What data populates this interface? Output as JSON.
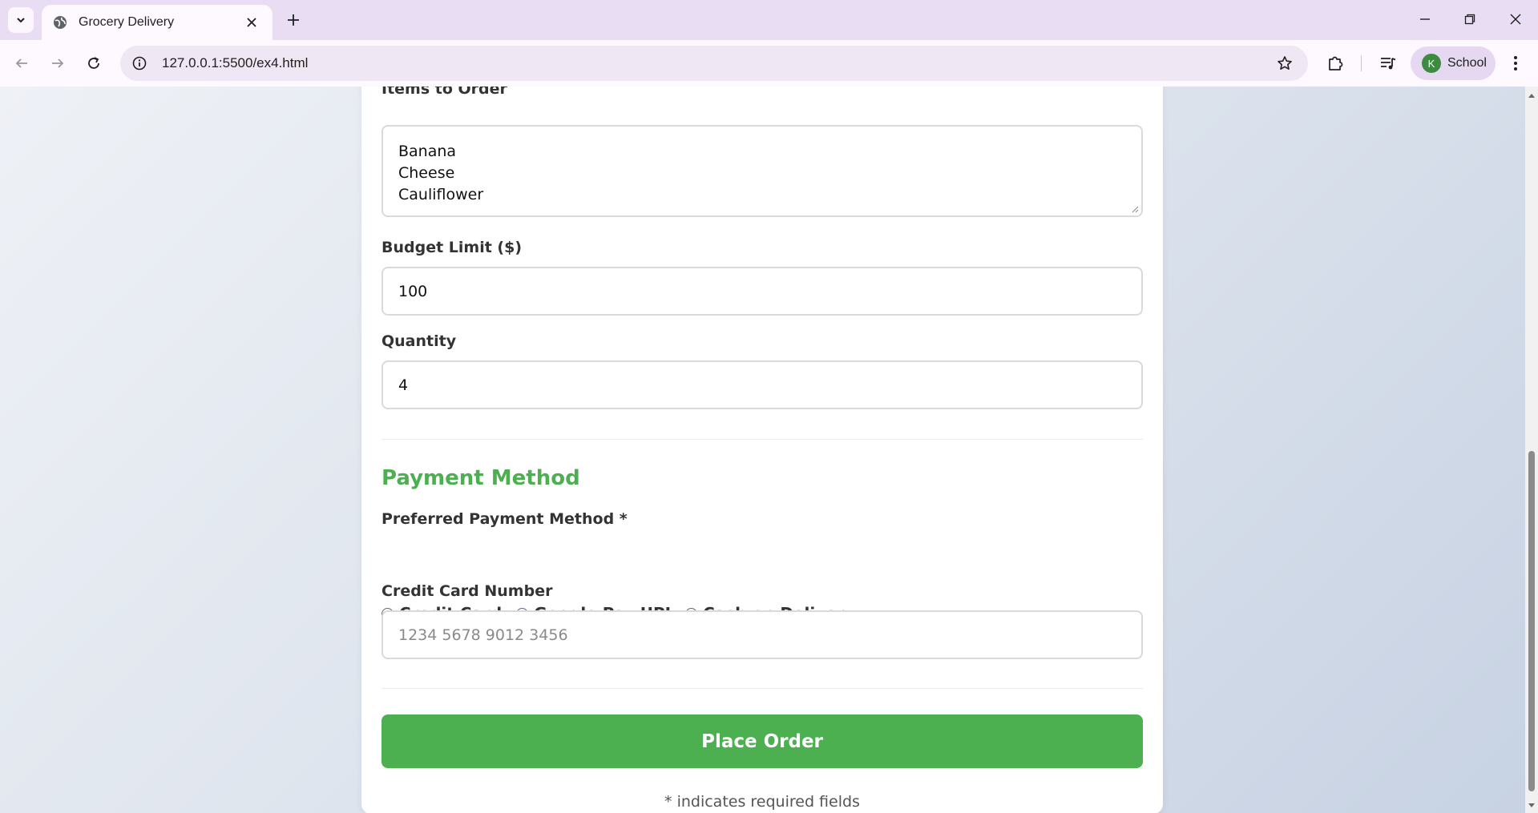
{
  "browser": {
    "tab_title": "Grocery Delivery",
    "url": "127.0.0.1:5500/ex4.html",
    "profile_initial": "K",
    "profile_name": "School",
    "profile_color": "#3d8b42"
  },
  "form": {
    "items_label": "Items to Order",
    "items_lines": [
      "Banana",
      "Cheese",
      "Cauliflower"
    ],
    "budget_label": "Budget Limit ($)",
    "budget_value": "100",
    "quantity_label": "Quantity",
    "quantity_value": "4",
    "payment_section_title": "Payment Method",
    "payment_label": "Preferred Payment Method *",
    "payment_options": [
      {
        "label": "Credit Card",
        "selected": false
      },
      {
        "label": "Google Pay UPI",
        "selected": true
      },
      {
        "label": "Cash on Delivery",
        "selected": false
      }
    ],
    "card_number_label": "Credit Card Number",
    "card_number_placeholder": "1234 5678 9012 3456",
    "submit_label": "Place Order",
    "footnote": "* indicates required fields"
  },
  "colors": {
    "accent_green": "#4caf50",
    "radio_selected": "#6f55b5"
  }
}
